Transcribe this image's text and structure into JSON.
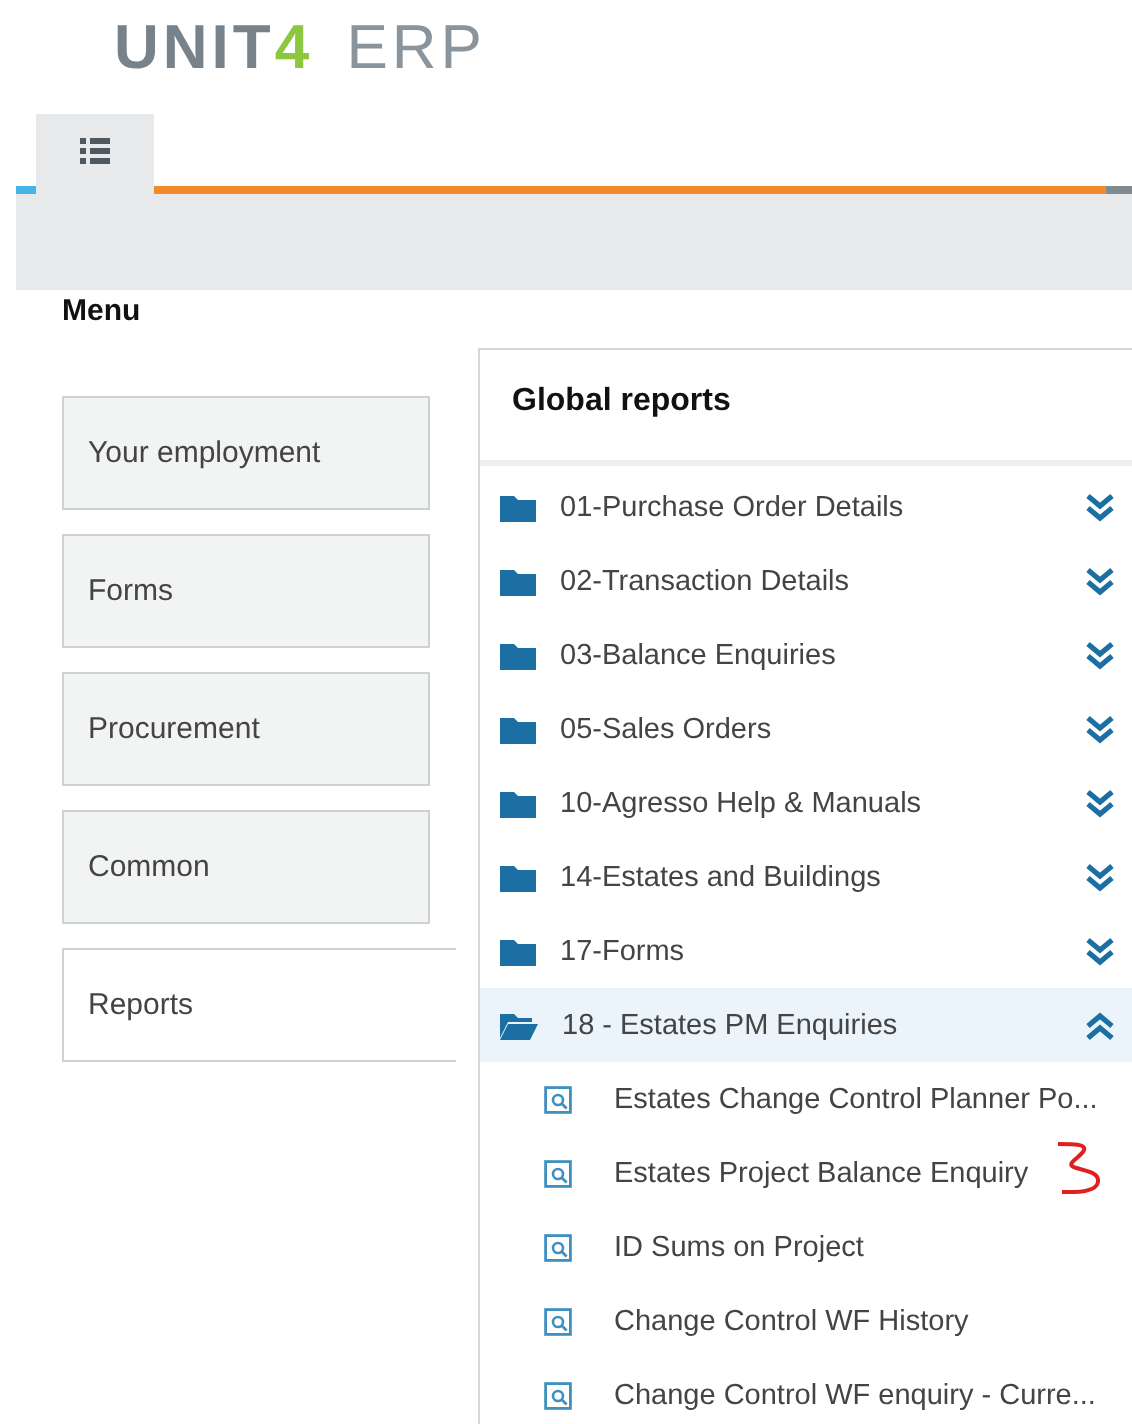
{
  "logo": {
    "brand": "UNIT",
    "digit": "4",
    "product": "ERP"
  },
  "menu": {
    "title": "Menu",
    "items": [
      {
        "label": "Your employment",
        "selected": false
      },
      {
        "label": "Forms",
        "selected": false
      },
      {
        "label": "Procurement",
        "selected": false
      },
      {
        "label": "Common",
        "selected": false
      },
      {
        "label": "Reports",
        "selected": true
      }
    ]
  },
  "reports": {
    "title": "Global reports",
    "folders": [
      {
        "label": "01-Purchase Order Details",
        "expanded": false
      },
      {
        "label": "02-Transaction Details",
        "expanded": false
      },
      {
        "label": "03-Balance Enquiries",
        "expanded": false
      },
      {
        "label": "05-Sales Orders",
        "expanded": false
      },
      {
        "label": "10-Agresso Help & Manuals",
        "expanded": false
      },
      {
        "label": "14-Estates and Buildings",
        "expanded": false
      },
      {
        "label": "17-Forms",
        "expanded": false
      },
      {
        "label": "18 - Estates PM Enquiries",
        "expanded": true,
        "children": [
          {
            "label": "Estates Change Control Planner Po..."
          },
          {
            "label": "Estates Project Balance Enquiry"
          },
          {
            "label": "ID Sums on Project"
          },
          {
            "label": "Change Control WF History"
          },
          {
            "label": "Change Control WF enquiry - Curre..."
          }
        ]
      }
    ]
  }
}
